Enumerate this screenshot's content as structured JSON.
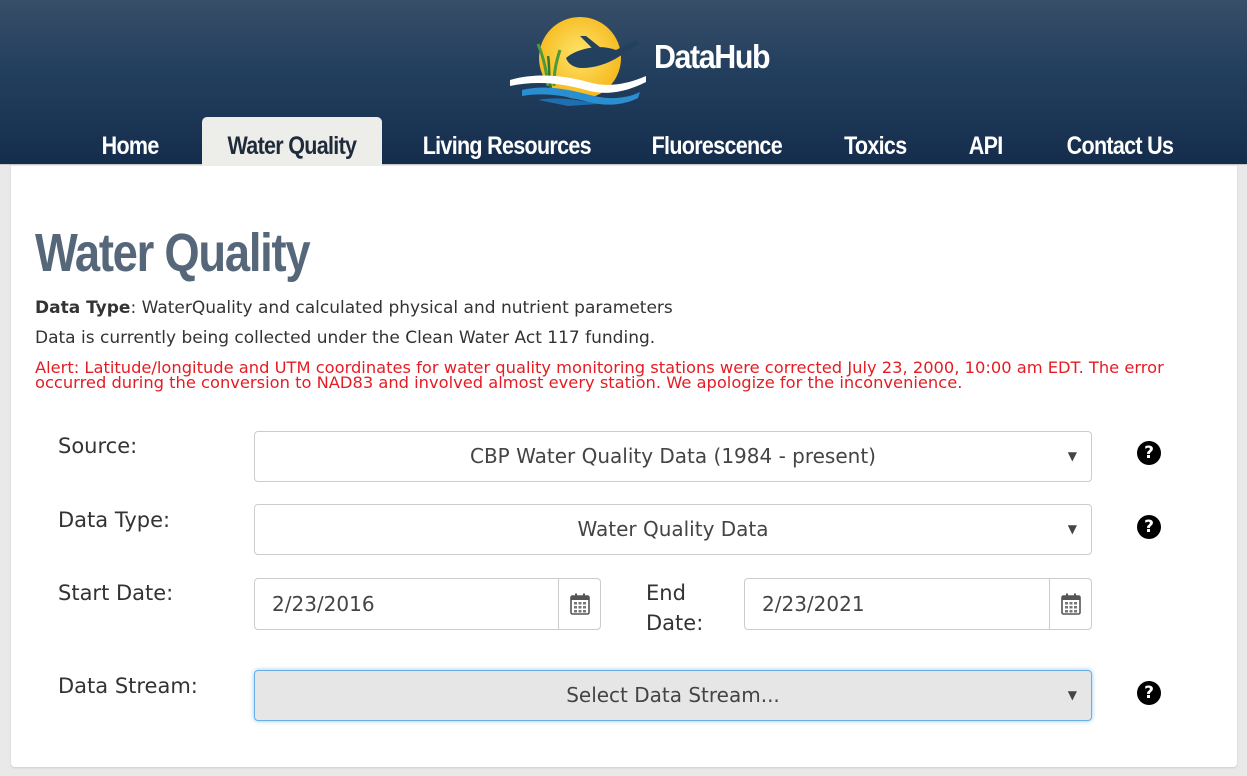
{
  "header": {
    "brand": "DataHub",
    "nav": [
      {
        "label": "Home",
        "active": false
      },
      {
        "label": "Water Quality",
        "active": true
      },
      {
        "label": "Living Resources",
        "active": false
      },
      {
        "label": "Fluorescence",
        "active": false
      },
      {
        "label": "Toxics",
        "active": false
      },
      {
        "label": "API",
        "active": false
      },
      {
        "label": "Contact Us",
        "active": false
      }
    ]
  },
  "page": {
    "title": "Water Quality",
    "data_type_label": "Data Type",
    "data_type_text": ": WaterQuality and calculated physical and nutrient parameters",
    "funding_text": "Data is currently being collected under the Clean Water Act 117 funding.",
    "alert_text": "Alert: Latitude/longitude and UTM coordinates for water quality monitoring stations were corrected July 23, 2000, 10:00 am EDT. The error occurred during the conversion to NAD83 and involved almost every station. We apologize for the inconvenience."
  },
  "form": {
    "source": {
      "label": "Source:",
      "value": "CBP Water Quality Data (1984 - present)"
    },
    "data_type": {
      "label": "Data Type:",
      "value": "Water Quality Data"
    },
    "start_date": {
      "label": "Start Date:",
      "value": "2/23/2016"
    },
    "end_date": {
      "label_line1": "End",
      "label_line2": "Date:",
      "value": "2/23/2021"
    },
    "data_stream": {
      "label": "Data Stream:",
      "value": "Select Data Stream..."
    },
    "help_glyph": "?",
    "caret_glyph": "▼"
  },
  "colors": {
    "header_dark": "#152d4d",
    "active_tab": "#ededea",
    "title": "#56677a",
    "alert": "#e51c23",
    "focus_border": "#66afe9"
  }
}
